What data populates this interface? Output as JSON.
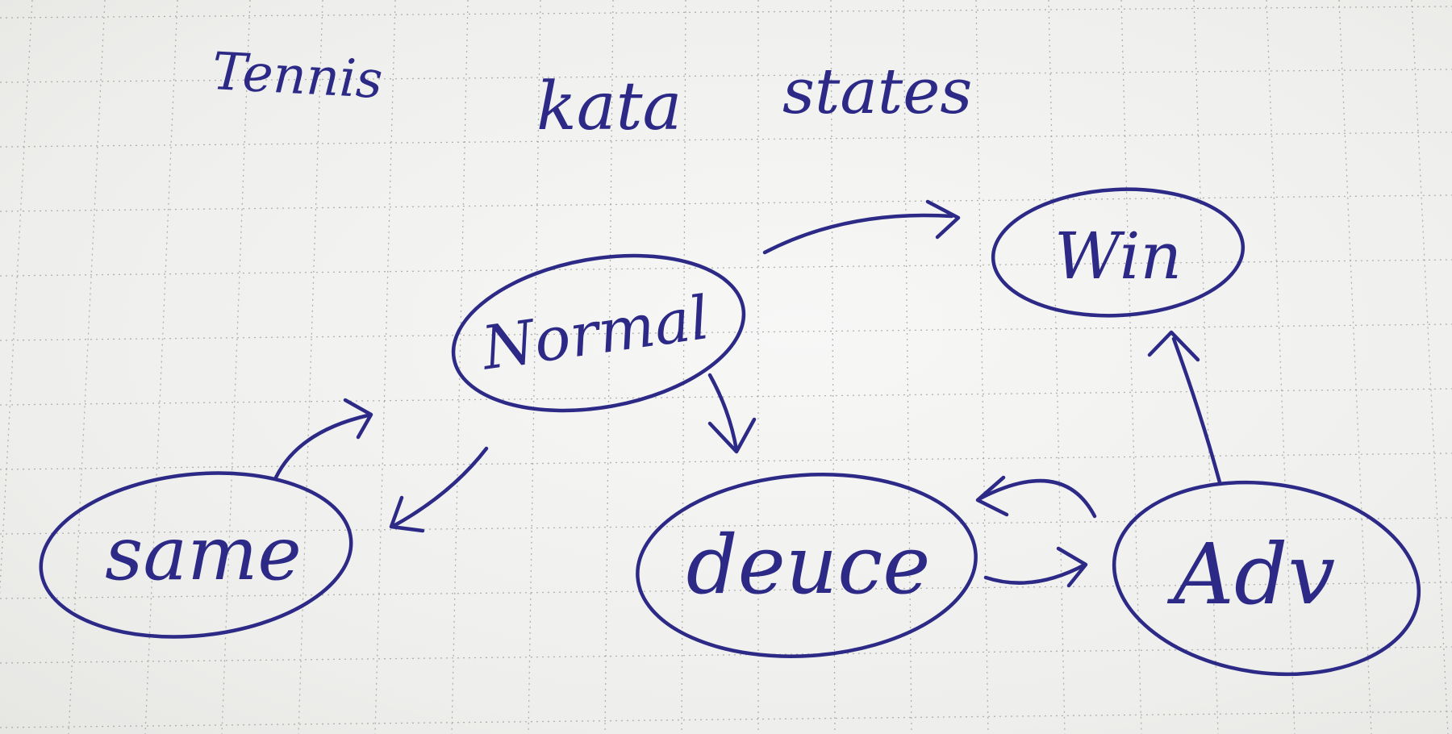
{
  "title": {
    "word1": "Tennis",
    "word2": "kata",
    "word3": "states"
  },
  "states": {
    "normal": "Normal",
    "win": "Win",
    "same": "same",
    "deuce": "deuce",
    "adv": "Adv"
  },
  "transitions": [
    {
      "from": "normal",
      "to": "win"
    },
    {
      "from": "normal",
      "to": "deuce"
    },
    {
      "from": "normal",
      "to": "same"
    },
    {
      "from": "same",
      "to": "normal"
    },
    {
      "from": "deuce",
      "to": "adv"
    },
    {
      "from": "adv",
      "to": "deuce"
    },
    {
      "from": "adv",
      "to": "win"
    }
  ],
  "ink_color": "#2c2a86"
}
